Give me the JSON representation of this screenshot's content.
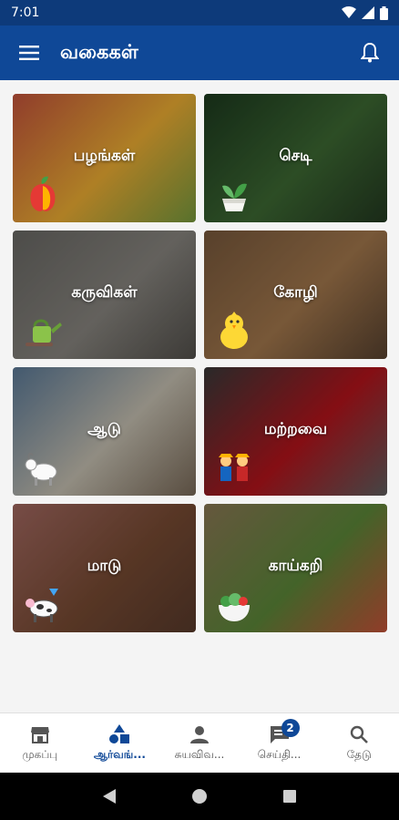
{
  "status_bar": {
    "time": "7:01"
  },
  "app_bar": {
    "title": "வகைகள்"
  },
  "categories": [
    {
      "label": "பழங்கள்",
      "icon": "fruit-icon",
      "bg": [
        "#c8553d",
        "#f2b134",
        "#7a9e3f"
      ]
    },
    {
      "label": "செடி",
      "icon": "plant-pot-icon",
      "bg": [
        "#1d3b1f",
        "#3e6b34",
        "#243a21"
      ]
    },
    {
      "label": "கருவிகள்",
      "icon": "watering-can-icon",
      "bg": [
        "#6b6a66",
        "#8a8781",
        "#55524d"
      ]
    },
    {
      "label": "கோழி",
      "icon": "chick-icon",
      "bg": [
        "#7a5a3d",
        "#a67a4e",
        "#5a4330"
      ]
    },
    {
      "label": "ஆடு",
      "icon": "goat-icon",
      "bg": [
        "#5d7c9a",
        "#c9c3b4",
        "#7c6c5a"
      ]
    },
    {
      "label": "மற்றவை",
      "icon": "farmers-icon",
      "bg": [
        "#3a3a3a",
        "#b8141c",
        "#606060"
      ]
    },
    {
      "label": "மாடு",
      "icon": "cow-icon",
      "bg": [
        "#a56a62",
        "#7a4c34",
        "#5a3b2c"
      ]
    },
    {
      "label": "காய்கறி",
      "icon": "vegetable-bowl-icon",
      "bg": [
        "#8d7a56",
        "#5e8a3a",
        "#c9543a"
      ]
    }
  ],
  "bottom_nav": [
    {
      "label": "முகப்பு",
      "icon": "home-store-icon",
      "active": false
    },
    {
      "label": "ஆர்வங்...",
      "icon": "shapes-icon",
      "active": true
    },
    {
      "label": "சுயவிவ...",
      "icon": "person-icon",
      "active": false
    },
    {
      "label": "செய்தி...",
      "icon": "chat-icon",
      "active": false,
      "badge": "2"
    },
    {
      "label": "தேடு",
      "icon": "search-icon",
      "active": false
    }
  ],
  "colors": {
    "primary": "#0f4897",
    "status_bar": "#0d3a7a"
  }
}
